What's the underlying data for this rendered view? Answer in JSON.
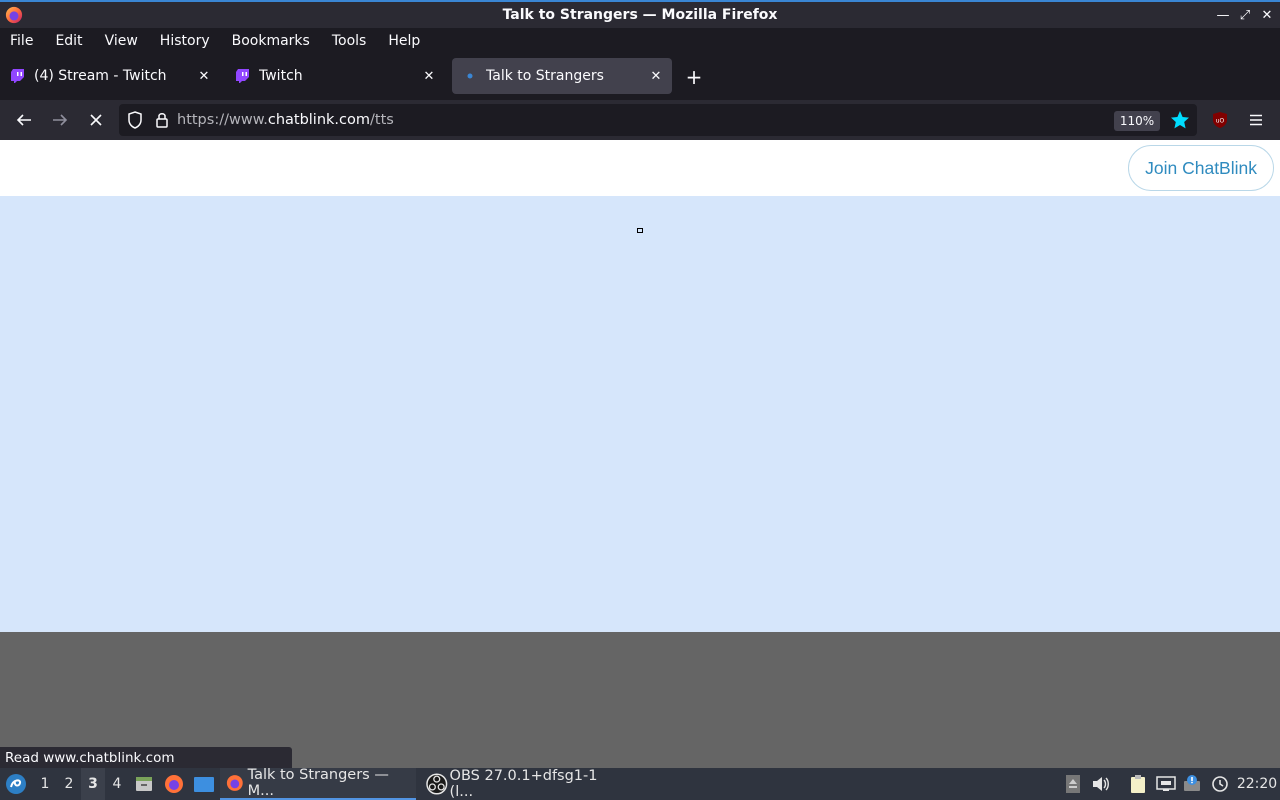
{
  "window": {
    "title": "Talk to Strangers — Mozilla Firefox",
    "controls": [
      "minimize",
      "maximize",
      "close"
    ]
  },
  "menu": {
    "items": [
      "File",
      "Edit",
      "View",
      "History",
      "Bookmarks",
      "Tools",
      "Help"
    ]
  },
  "tabs": [
    {
      "label": "(4) Stream - Twitch",
      "icon": "twitch-icon",
      "active": false
    },
    {
      "label": "Twitch",
      "icon": "twitch-icon",
      "active": false
    },
    {
      "label": "Talk to Strangers",
      "icon": "loading-dot-icon",
      "active": true
    }
  ],
  "navbar": {
    "url_prefix": "https://www.",
    "url_host": "chatblink.com",
    "url_path": "/tts",
    "zoom": "110%"
  },
  "page": {
    "join_button": "Join ChatBlink"
  },
  "status_text": "Read www.chatblink.com",
  "taskbar": {
    "workspaces": [
      "1",
      "2",
      "3",
      "4"
    ],
    "active_workspace": "3",
    "tasks": [
      {
        "label": "Talk to Strangers — M...",
        "icon": "firefox-icon",
        "active": true
      },
      {
        "label": "OBS 27.0.1+dfsg1-1 (l...",
        "icon": "obs-icon",
        "active": false
      }
    ],
    "clock": "22:20"
  },
  "colors": {
    "accent": "#5294e2",
    "page_bg": "#d6e6fb",
    "join_text": "#2f8bbf",
    "bookmark_star": "#00ddff"
  }
}
